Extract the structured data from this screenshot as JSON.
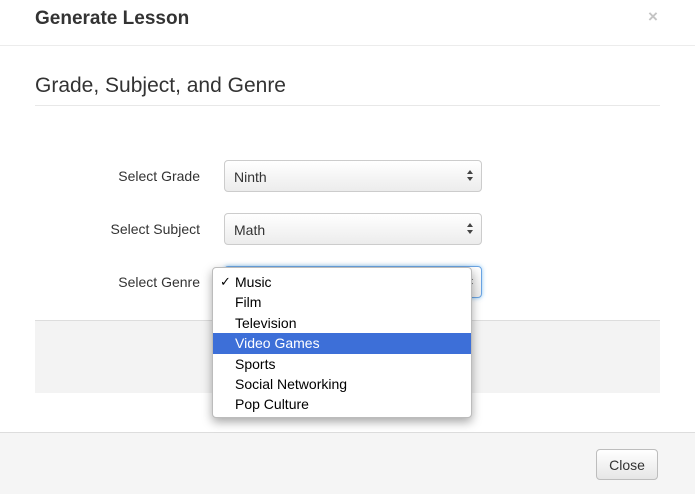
{
  "modal": {
    "title": "Generate Lesson",
    "close_icon": "×",
    "section_title": "Grade, Subject, and Genre"
  },
  "form": {
    "grade": {
      "label": "Select Grade",
      "value": "Ninth"
    },
    "subject": {
      "label": "Select Subject",
      "value": "Math"
    },
    "genre": {
      "label": "Select Genre",
      "value": "Music"
    }
  },
  "dropdown": {
    "check_icon": "✓",
    "selected": "Music",
    "highlighted": "Video Games",
    "options": [
      "Music",
      "Film",
      "Television",
      "Video Games",
      "Sports",
      "Social Networking",
      "Pop Culture"
    ]
  },
  "footer": {
    "close_label": "Close"
  },
  "icons": [
    "close-icon",
    "select-arrows-icon",
    "checkmark-icon"
  ],
  "colors": {
    "highlight": "#3d6fd8",
    "focus_ring": "#6aa4e3",
    "footer_bg": "#f5f5f5"
  }
}
